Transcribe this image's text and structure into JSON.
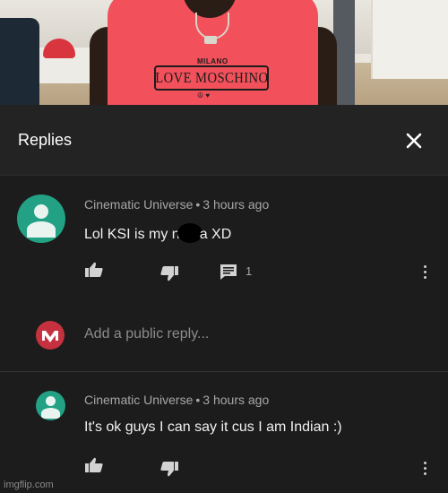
{
  "video": {
    "shirt_small_text": "MILANO",
    "shirt_brand": "LOVE MOSCHINO"
  },
  "replies_panel": {
    "title": "Replies"
  },
  "comments": [
    {
      "author": "Cinematic Universe",
      "time": "3 hours ago",
      "text_before": "Lol KSI is my n",
      "text_after": "a XD",
      "reply_count": "1"
    },
    {
      "author": "Cinematic Universe",
      "time": "3 hours ago",
      "text": "It's ok guys I can say it cus I am Indian :)"
    }
  ],
  "reply_box": {
    "placeholder": "Add a public reply..."
  },
  "watermark": "imgflip.com",
  "colors": {
    "background": "#1c1c1c",
    "avatar": "#23a184",
    "shirt": "#f2505b",
    "my_avatar": "#c5313f"
  },
  "icons": [
    "close-icon",
    "thumbs-up-icon",
    "thumbs-down-icon",
    "comment-icon",
    "more-vert-icon"
  ]
}
